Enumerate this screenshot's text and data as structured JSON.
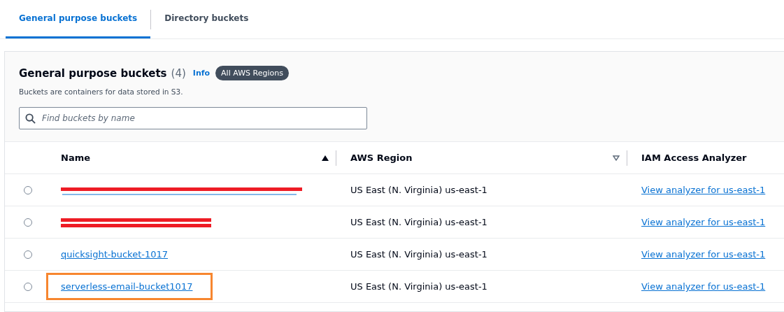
{
  "tabs": [
    {
      "label": "General purpose buckets",
      "selected": true
    },
    {
      "label": "Directory buckets",
      "selected": false
    }
  ],
  "panel": {
    "title": "General purpose buckets",
    "count": "(4)",
    "info": "Info",
    "badge": "All AWS Regions",
    "description": "Buckets are containers for data stored in S3.",
    "search": {
      "placeholder": "Find buckets by name"
    }
  },
  "table": {
    "columns": [
      {
        "label": "Name",
        "sortable": true,
        "sorted": true
      },
      {
        "label": "AWS Region",
        "sortable": true,
        "sorted": false
      },
      {
        "label": "IAM Access Analyzer",
        "sortable": false
      }
    ],
    "rows": [
      {
        "kind": "redacted",
        "selected": false,
        "highlighted": false,
        "region": "US East (N. Virginia) us-east-1",
        "analyzer": "View analyzer for us-east-1"
      },
      {
        "kind": "redacted",
        "selected": false,
        "highlighted": false,
        "region": "US East (N. Virginia) us-east-1",
        "analyzer": "View analyzer for us-east-1"
      },
      {
        "kind": "named",
        "name": "quicksight-bucket-1017",
        "selected": false,
        "highlighted": false,
        "region": "US East (N. Virginia) us-east-1",
        "analyzer": "View analyzer for us-east-1"
      },
      {
        "kind": "named",
        "name": "serverless-email-bucket1017",
        "selected": false,
        "highlighted": true,
        "region": "US East (N. Virginia) us-east-1",
        "analyzer": "View analyzer for us-east-1"
      }
    ]
  }
}
